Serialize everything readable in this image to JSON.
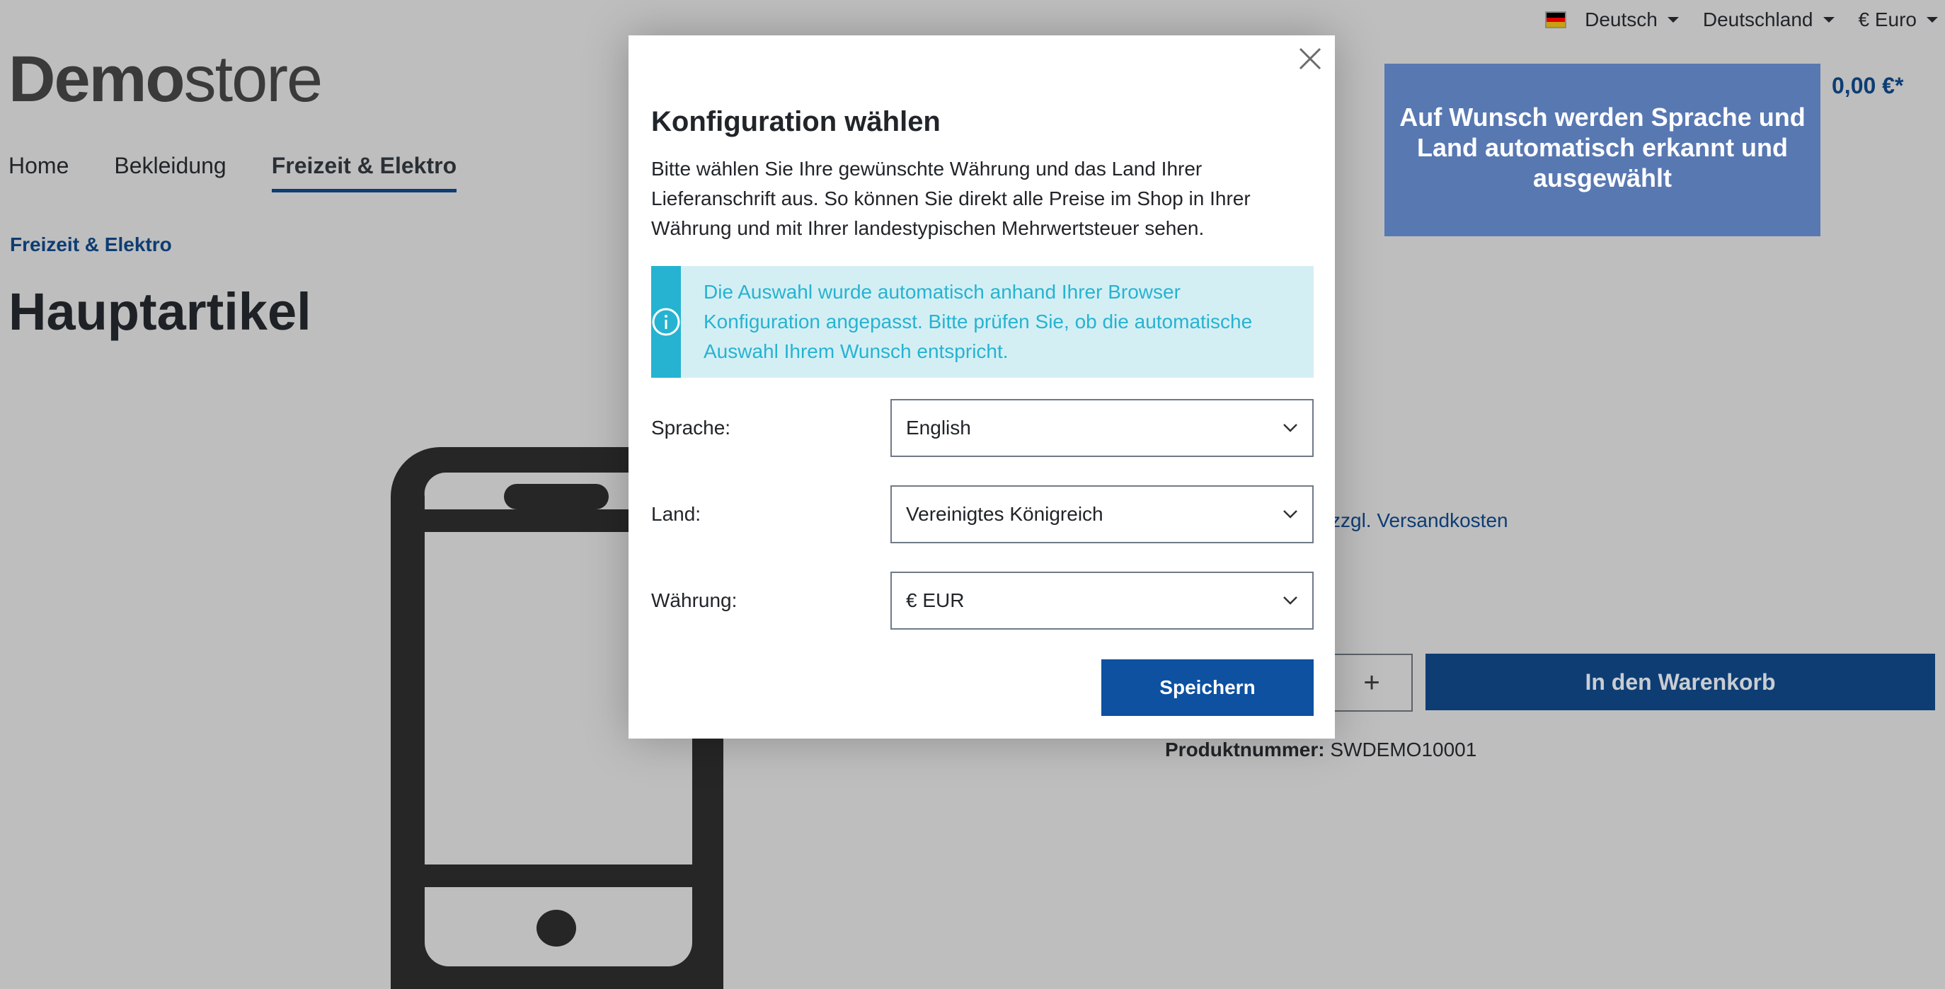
{
  "topbar": {
    "language": "Deutsch",
    "country": "Deutschland",
    "currency": "€ Euro"
  },
  "logo": {
    "bold": "Demo",
    "light": "store"
  },
  "cart": {
    "price": "0,00 €*"
  },
  "nav": {
    "items": [
      {
        "label": "Home"
      },
      {
        "label": "Bekleidung"
      },
      {
        "label": "Freizeit & Elektro"
      }
    ]
  },
  "breadcrumb": "Freizeit & Elektro",
  "page_title": "Hauptartikel",
  "product": {
    "shipping_text": "zzgl. Versandkosten",
    "qty_plus": "+",
    "add_to_cart": "In den Warenkorb",
    "number_label": "Produktnummer:",
    "number_value": "SWDEMO10001"
  },
  "hint": "Auf Wunsch werden Sprache und Land automatisch erkannt und ausgewählt",
  "modal": {
    "title": "Konfiguration wählen",
    "intro": "Bitte wählen Sie Ihre gewünschte Währung und das Land Ihrer Lieferanschrift aus. So können Sie direkt alle Preise im Shop in Ihrer Währung und mit Ihrer landestypischen Mehrwertsteuer sehen.",
    "alert": "Die Auswahl wurde automatisch anhand Ihrer Browser Konfiguration angepasst. Bitte prüfen Sie, ob die automatische Auswahl Ihrem Wunsch entspricht.",
    "fields": [
      {
        "label": "Sprache:",
        "value": "English"
      },
      {
        "label": "Land:",
        "value": "Vereinigtes Königreich"
      },
      {
        "label": "Währung:",
        "value": "€ EUR"
      }
    ],
    "save": "Speichern"
  }
}
